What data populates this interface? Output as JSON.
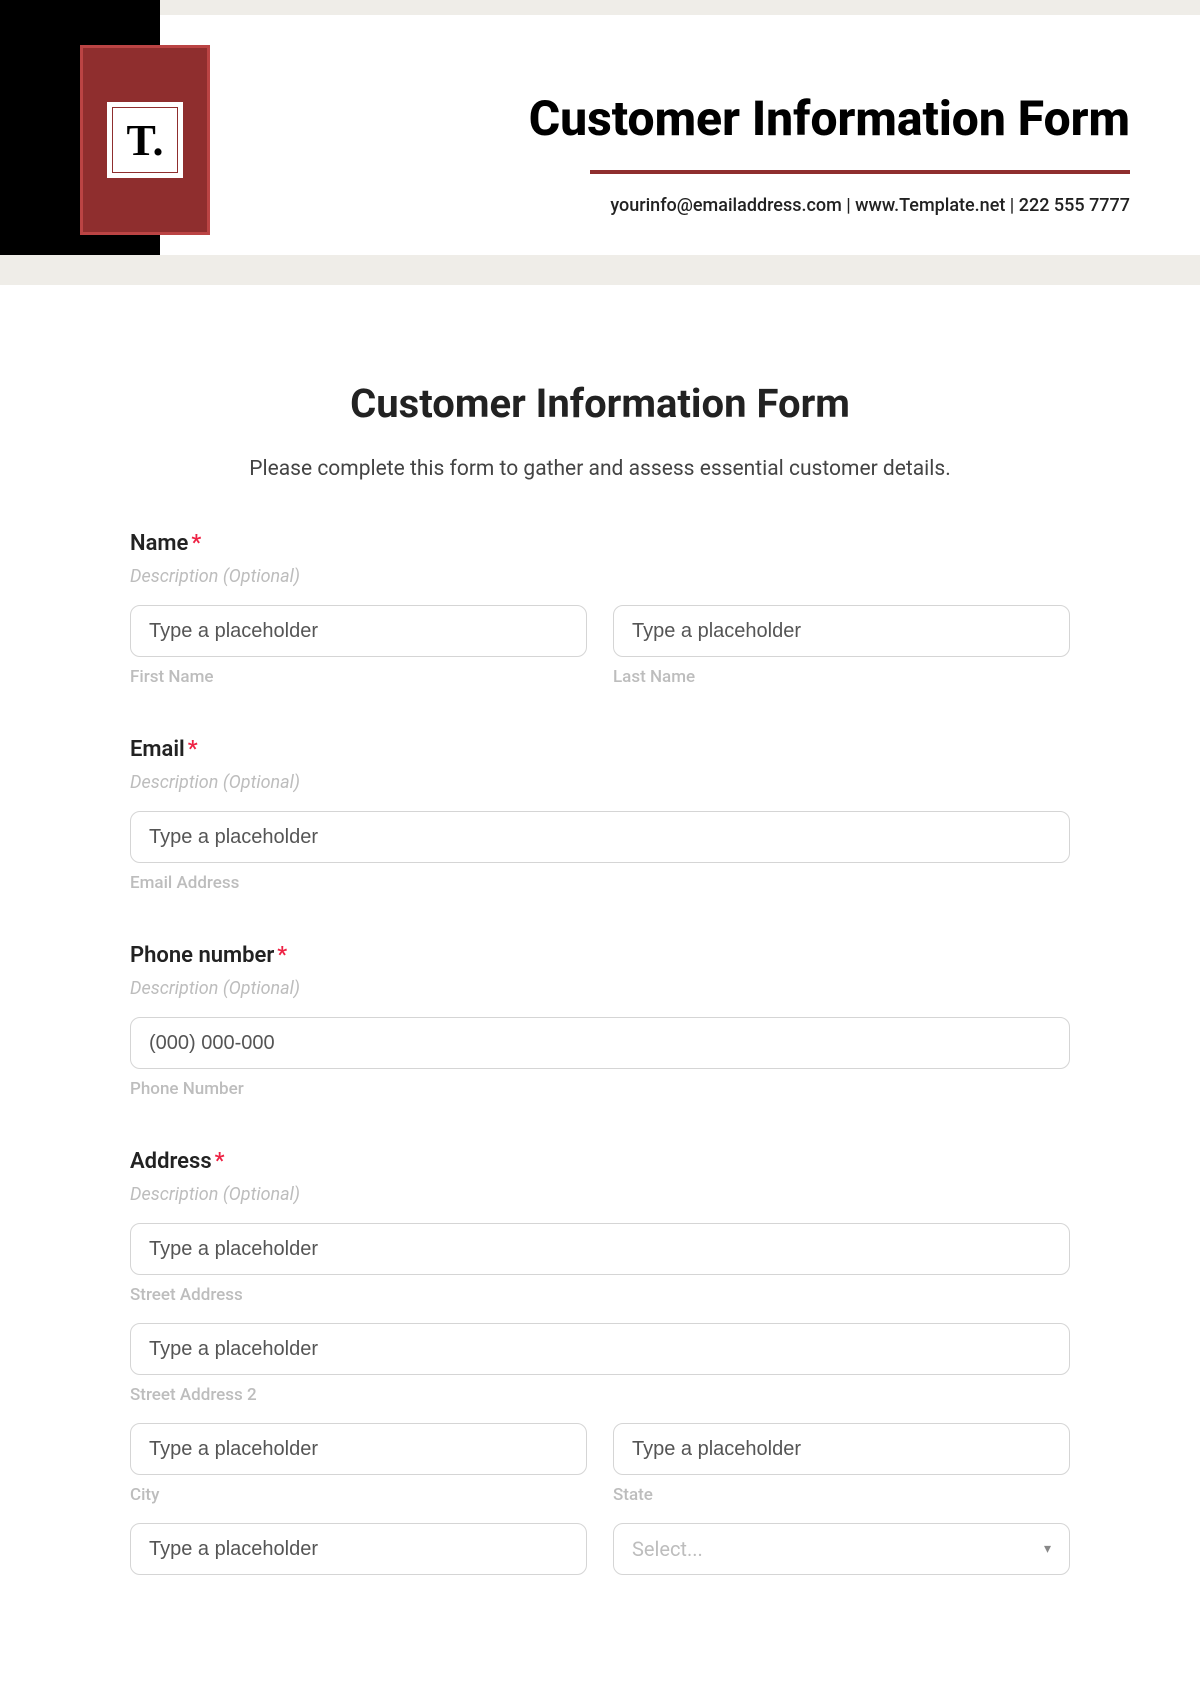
{
  "header": {
    "logo_letter": "T.",
    "title": "Customer Information Form",
    "contact": "yourinfo@emailaddress.com  |  www.Template.net  |  222 555 7777"
  },
  "form": {
    "title": "Customer Information Form",
    "subtitle": "Please complete this form to gather and assess essential customer details.",
    "desc_placeholder": "Description (Optional)",
    "required_mark": "*",
    "fields": {
      "name": {
        "label": "Name",
        "first_placeholder": "Type a placeholder",
        "first_sub": "First Name",
        "last_placeholder": "Type a placeholder",
        "last_sub": "Last Name"
      },
      "email": {
        "label": "Email",
        "placeholder": "Type a placeholder",
        "sub": "Email Address"
      },
      "phone": {
        "label": "Phone number",
        "placeholder": "(000) 000-000",
        "sub": "Phone Number"
      },
      "address": {
        "label": "Address",
        "street_placeholder": "Type a placeholder",
        "street_sub": "Street Address",
        "street2_placeholder": "Type a placeholder",
        "street2_sub": "Street Address 2",
        "city_placeholder": "Type a placeholder",
        "city_sub": "City",
        "state_placeholder": "Type a placeholder",
        "state_sub": "State",
        "zip_placeholder": "Type a placeholder",
        "country_select": "Select..."
      }
    }
  }
}
